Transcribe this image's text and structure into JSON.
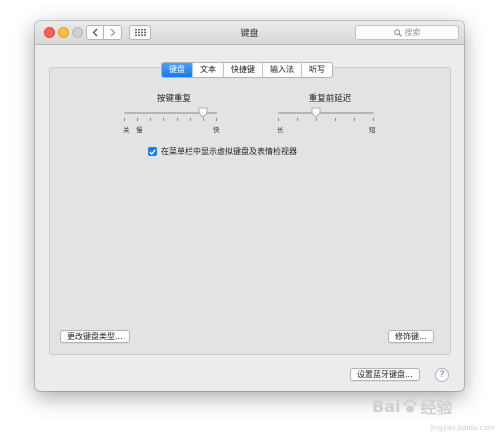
{
  "window": {
    "title": "键盘",
    "search_placeholder": "搜索"
  },
  "tabs": [
    {
      "label": "键盘",
      "active": true
    },
    {
      "label": "文本",
      "active": false
    },
    {
      "label": "快捷键",
      "active": false
    },
    {
      "label": "输入法",
      "active": false
    },
    {
      "label": "听写",
      "active": false
    }
  ],
  "key_repeat": {
    "label": "按键重复",
    "min_label": "关",
    "slow_label": "慢",
    "max_label": "快",
    "level": 0.85
  },
  "delay_until_repeat": {
    "label": "重复前延迟",
    "min_label": "长",
    "max_label": "短",
    "level": 0.4
  },
  "show_viewer_checkbox": {
    "label": "在菜单栏中显示虚拟键盘及表情检视器",
    "checked": true
  },
  "buttons": {
    "change_keyboard_type": "更改键盘类型...",
    "modifier_keys": "修饰键...",
    "setup_bluetooth_keyboard": "设置蓝牙键盘...",
    "help": "?"
  },
  "watermark": {
    "text": "Bai",
    "suffix": "经验",
    "sub": "jingyan.baidu.com"
  },
  "colors": {
    "accent": "#1a78ee",
    "close": "#fc605c",
    "minimize": "#fdbc40",
    "zoom_disabled": "#cfcfcf"
  },
  "icons": [
    "close-button",
    "minimize-button",
    "zoom-button",
    "chevron-left-icon",
    "chevron-right-icon",
    "grid-icon",
    "search-icon",
    "checkmark-icon",
    "paw-icon"
  ]
}
